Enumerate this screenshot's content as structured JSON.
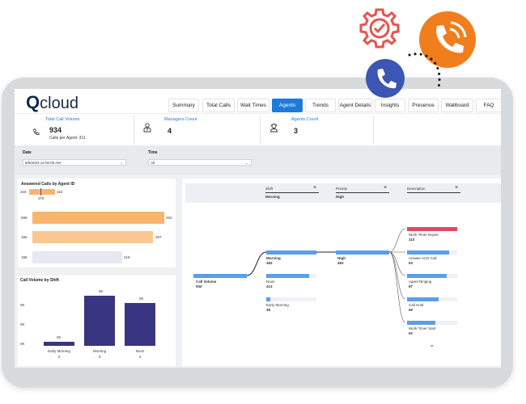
{
  "logo": {
    "text": "cloud",
    "q": "Q"
  },
  "tabs": [
    {
      "label": "Summary",
      "active": false
    },
    {
      "label": "Total Calls",
      "active": false
    },
    {
      "label": "Wait Times",
      "active": false
    },
    {
      "label": "Agents",
      "active": true
    },
    {
      "label": "Trends",
      "active": false
    },
    {
      "label": "Agent Details",
      "active": false
    },
    {
      "label": "Insights",
      "active": false
    },
    {
      "label": "Presence",
      "active": false
    },
    {
      "label": "Wallboard",
      "active": false
    },
    {
      "label": "FAQ",
      "active": false
    }
  ],
  "kpis": {
    "total_call_volume": {
      "title": "Total Call Volume",
      "value": "934",
      "sub": "Calls per Agent: 311"
    },
    "managers_count": {
      "title": "Managers Count",
      "value": "4"
    },
    "agents_count": {
      "title": "Agents Count",
      "value": "3"
    }
  },
  "filters": {
    "date": {
      "label": "Date",
      "value": "5/9/2023 12:00:00 AM"
    },
    "time": {
      "label": "Time",
      "value": "All"
    }
  },
  "answered_calls": {
    "title": "Answered Calls by Agent ID",
    "top": {
      "left": "218",
      "right": "322",
      "below": "270"
    },
    "rows": [
      {
        "id": "589",
        "value": "322",
        "color": "#f7b56e"
      },
      {
        "id": "156",
        "value": "287",
        "color": "#f9c78f"
      },
      {
        "id": "166",
        "value": "219",
        "color": "#e6e8f2"
      }
    ]
  },
  "shift_chart": {
    "title": "Call Volume by Shift",
    "y_ticks": [
      "0K",
      "0K",
      "0K",
      "0K"
    ],
    "bars": [
      {
        "label": "Early Morning",
        "count": "2",
        "data_label": "0K"
      },
      {
        "label": "Morning",
        "count": "3",
        "data_label": "0K"
      },
      {
        "label": "Noon",
        "count": "4",
        "data_label": "0K"
      }
    ]
  },
  "decomp": {
    "columns": [
      {
        "header": "Shift",
        "selected": "Morning"
      },
      {
        "header": "Priority",
        "selected": "High"
      },
      {
        "header": "Description",
        "selected": ""
      }
    ],
    "close_symbol": "×",
    "root": {
      "label": "Call Volume",
      "value": "934"
    },
    "shift_nodes": [
      {
        "label": "Morning",
        "value": "483"
      },
      {
        "label": "Noon",
        "value": "413"
      },
      {
        "label": "Early Morning",
        "value": "38"
      }
    ],
    "priority_node": {
      "label": "High",
      "value": "483"
    },
    "description_nodes": [
      {
        "label": "Work Timer Expire",
        "value": "110"
      },
      {
        "label": "Answer ACD Call",
        "value": "93"
      },
      {
        "label": "Agent Ringing",
        "value": "87"
      },
      {
        "label": "Call Hold",
        "value": "69"
      },
      {
        "label": "Work Timer Start",
        "value": "62"
      }
    ],
    "more_symbol": "⌄"
  },
  "colors": {
    "accent": "#1f7bd8",
    "decomp_bar": "#5b9ee8",
    "highlight_bar": "#e04a5f",
    "shift_bars": "#3a3580",
    "gear": "#e5544f",
    "phone_orange": "#f07e1d",
    "phone_blue": "#3b56b3"
  }
}
